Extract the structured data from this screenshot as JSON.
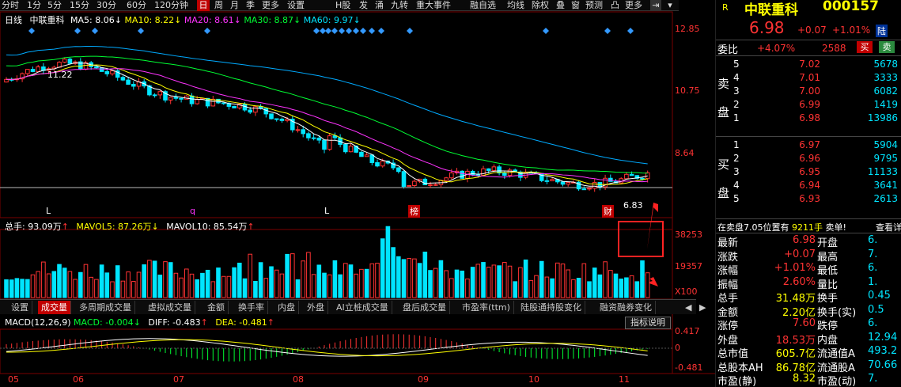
{
  "toolbar": {
    "items": [
      "分时",
      "1分",
      "5分",
      "15分",
      "30分",
      "60分",
      "120分钟",
      "日",
      "周",
      "月",
      "季",
      "更多",
      "设置",
      "H股",
      "发",
      "涌",
      "九转",
      "重大事件",
      "融自选",
      "均线",
      "除权",
      "叠",
      "窗",
      "预测",
      "凸",
      "更多"
    ],
    "selected": "日"
  },
  "chart_header": {
    "period": "日线",
    "name": "中联重科",
    "ma5": "MA5: 8.06",
    "ma10": "MA10: 8.22",
    "ma20": "MA20: 8.61",
    "ma30": "MA30: 8.87",
    "ma60": "MA60: 9.97"
  },
  "price_axis": [
    "12.85",
    "10.75",
    "8.64"
  ],
  "annotations": {
    "high_label": "11.22",
    "low_label": "6.83",
    "L1": "L",
    "q": "q",
    "L2": "L",
    "bang": "榜",
    "cai": "财"
  },
  "volume_header": {
    "total": "总手: 93.09万",
    "mavol5": "MAVOL5: 87.26万",
    "mavol10": "MAVOL10: 85.54万"
  },
  "volume_axis": [
    "38253",
    "19357",
    "X100"
  ],
  "tabs": [
    "设置",
    "成交量",
    "多周期成交量",
    "虚拟成交量",
    "金额",
    "换手率",
    "内盘",
    "外盘",
    "AI立桩成交量",
    "盘后成交量",
    "市盈率(ttm)",
    "陆股通持股变化",
    "融资融券变化"
  ],
  "tab_selected": "成交量",
  "macd_header": {
    "label": "MACD(12,26,9)",
    "macd": "MACD: -0.004",
    "diff": "DIFF: -0.483",
    "dea": "DEA: -0.481",
    "explain": "指标说明"
  },
  "macd_axis": [
    "0.417",
    "0",
    "-0.481"
  ],
  "date_axis": [
    "05",
    "06",
    "07",
    "08",
    "09",
    "10",
    "11"
  ],
  "quote": {
    "market": "R",
    "name": "中联重科",
    "code": "000157",
    "price": "6.98",
    "change": "+0.07",
    "pct": "+1.01%",
    "tag": "陆",
    "weibi_label": "委比",
    "weibi": "+4.07%",
    "weicha": "2588",
    "buy_btn": "买",
    "sell_btn": "卖",
    "sell_label": [
      "卖",
      "盘"
    ],
    "buy_label": [
      "买",
      "盘"
    ],
    "asks": [
      {
        "lvl": "5",
        "p": "7.02",
        "v": "5678"
      },
      {
        "lvl": "4",
        "p": "7.01",
        "v": "3333"
      },
      {
        "lvl": "3",
        "p": "7.00",
        "v": "6082"
      },
      {
        "lvl": "2",
        "p": "6.99",
        "v": "1419"
      },
      {
        "lvl": "1",
        "p": "6.98",
        "v": "13986"
      }
    ],
    "bids": [
      {
        "lvl": "1",
        "p": "6.97",
        "v": "5904"
      },
      {
        "lvl": "2",
        "p": "6.96",
        "v": "9795"
      },
      {
        "lvl": "3",
        "p": "6.95",
        "v": "11133"
      },
      {
        "lvl": "4",
        "p": "6.94",
        "v": "3641"
      },
      {
        "lvl": "5",
        "p": "6.93",
        "v": "2613"
      }
    ],
    "info_bar": "在卖盘7.05位置有",
    "info_vol": "9211手",
    "info_sell": "卖单!",
    "info_link": "查看详",
    "stats": [
      {
        "k": "最新",
        "v": "6.98",
        "k2": "开盘",
        "v2": "6."
      },
      {
        "k": "涨跌",
        "v": "+0.07",
        "k2": "最高",
        "v2": "7."
      },
      {
        "k": "涨幅",
        "v": "+1.01%",
        "k2": "最低",
        "v2": "6."
      },
      {
        "k": "振幅",
        "v": "2.60%",
        "k2": "量比",
        "v2": "1."
      },
      {
        "k": "总手",
        "v": "31.48万",
        "k2": "换手",
        "v2": "0.45"
      },
      {
        "k": "金额",
        "v": "2.20亿",
        "k2": "换手(实)",
        "v2": "0.5"
      },
      {
        "k": "涨停",
        "v": "7.60",
        "k2": "跌停",
        "v2": "6."
      },
      {
        "k": "外盘",
        "v": "18.53万",
        "k2": "内盘",
        "v2": "12.94"
      },
      {
        "k": "总市值",
        "v": "605.7亿",
        "k2": "流通值A",
        "v2": "493.2"
      },
      {
        "k": "总股本AH",
        "v": "86.78亿",
        "k2": "流通股A",
        "v2": "70.66"
      },
      {
        "k": "市盈(静)",
        "v": "8.32",
        "k2": "市盈(动)",
        "v2": "7."
      }
    ]
  }
}
